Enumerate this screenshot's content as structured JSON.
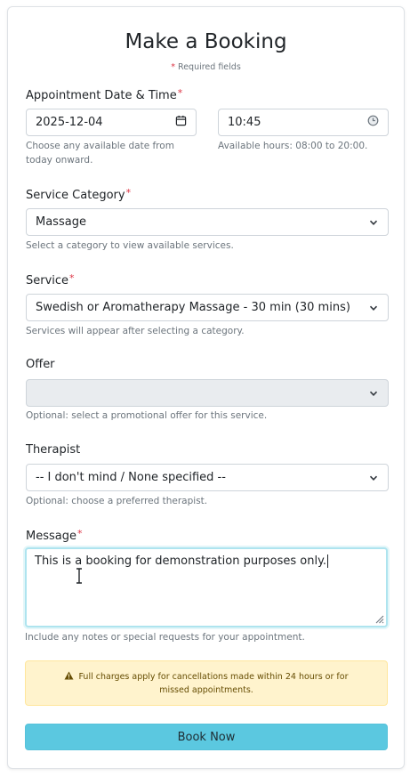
{
  "form": {
    "title": "Make a Booking",
    "required_note": "Required fields",
    "required_star": "*"
  },
  "datetime": {
    "label": "Appointment Date & Time",
    "date_value": "2025-12-04",
    "time_value": "10:45",
    "date_help": "Choose any available date from today onward.",
    "time_help": "Available hours: 08:00 to 20:00."
  },
  "category": {
    "label": "Service Category",
    "value": "Massage",
    "help": "Select a category to view available services."
  },
  "service": {
    "label": "Service",
    "value": "Swedish or Aromatherapy Massage - 30 min (30 mins)",
    "help": "Services will appear after selecting a category."
  },
  "offer": {
    "label": "Offer",
    "value": "",
    "help": "Optional: select a promotional offer for this service."
  },
  "therapist": {
    "label": "Therapist",
    "value": "-- I don't mind / None specified --",
    "help": "Optional: choose a preferred therapist."
  },
  "message": {
    "label": "Message",
    "value": "This is a booking for demonstration purposes only.",
    "help": "Include any notes or special requests for your appointment."
  },
  "alert": {
    "text": "Full charges apply for cancellations made within 24 hours or for missed appointments."
  },
  "submit": {
    "label": "Book Now"
  },
  "colors": {
    "required": "#dc3545",
    "button": "#5bc8e0",
    "alert_bg": "#fff3cd",
    "focus_border": "#aee4ef"
  }
}
